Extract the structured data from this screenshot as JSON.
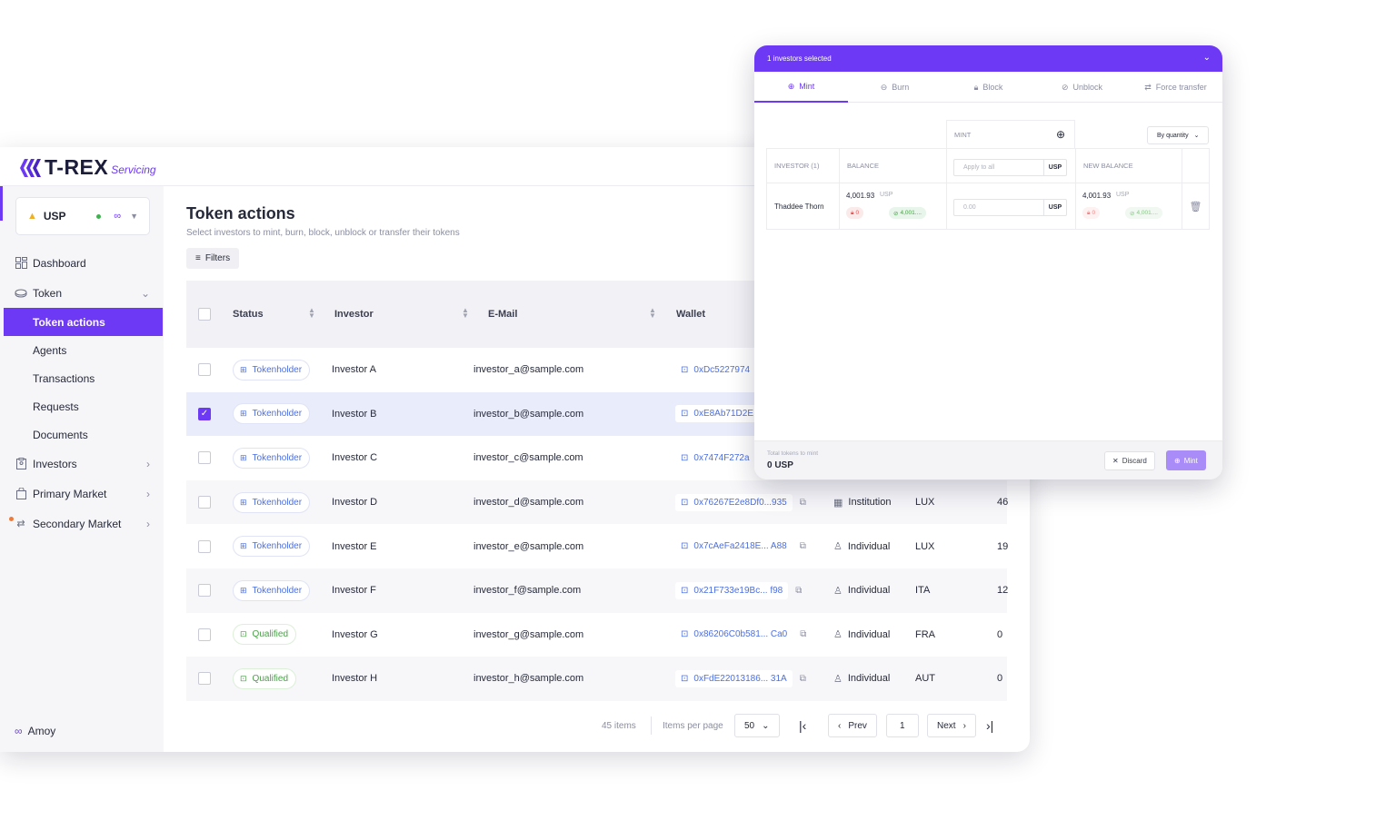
{
  "brand": {
    "name": "T-REX",
    "suffix": "Servicing",
    "accent": "#6d39f5"
  },
  "sidebar": {
    "token": {
      "symbol": "USP"
    },
    "items": [
      {
        "label": "Dashboard",
        "icon": "dashboard-icon"
      },
      {
        "label": "Token",
        "icon": "token-icon",
        "expanded": true
      }
    ],
    "token_sub": [
      "Token actions",
      "Agents",
      "Transactions",
      "Requests",
      "Documents"
    ],
    "more_items": [
      {
        "label": "Investors",
        "icon": "investors-icon"
      },
      {
        "label": "Primary Market",
        "icon": "primary-market-icon"
      },
      {
        "label": "Secondary Market",
        "icon": "secondary-market-icon"
      }
    ],
    "network": "Amoy"
  },
  "page": {
    "title": "Token actions",
    "subtitle": "Select investors to mint, burn, block, unblock or transfer their tokens",
    "filters_label": "Filters"
  },
  "table": {
    "columns": [
      "Status",
      "Investor",
      "E-Mail",
      "Wallet"
    ],
    "rows": [
      {
        "status": "Tokenholder",
        "investor": "Investor A",
        "email": "investor_a@sample.com",
        "wallet": "0xDc5227974",
        "type": "",
        "country": "",
        "amount": "",
        "checked": false
      },
      {
        "status": "Tokenholder",
        "investor": "Investor B",
        "email": "investor_b@sample.com",
        "wallet": "0xE8Ab71D2E",
        "type": "",
        "country": "",
        "amount": "",
        "checked": true
      },
      {
        "status": "Tokenholder",
        "investor": "Investor C",
        "email": "investor_c@sample.com",
        "wallet": "0x7474F272a",
        "type": "",
        "country": "",
        "amount": "",
        "checked": false
      },
      {
        "status": "Tokenholder",
        "investor": "Investor D",
        "email": "investor_d@sample.com",
        "wallet": "0x76267E2e8Df0...935",
        "type": "Institution",
        "country": "LUX",
        "amount": "46",
        "checked": false
      },
      {
        "status": "Tokenholder",
        "investor": "Investor E",
        "email": "investor_e@sample.com",
        "wallet": "0x7cAeFa2418E... A88",
        "type": "Individual",
        "country": "LUX",
        "amount": "19",
        "checked": false
      },
      {
        "status": "Tokenholder",
        "investor": "Investor F",
        "email": "investor_f@sample.com",
        "wallet": "0x21F733e19Bc... f98",
        "type": "Individual",
        "country": "ITA",
        "amount": "12",
        "checked": false
      },
      {
        "status": "Qualified",
        "investor": "Investor G",
        "email": "investor_g@sample.com",
        "wallet": "0x86206C0b581... Ca0",
        "type": "Individual",
        "country": "FRA",
        "amount": "0",
        "checked": false
      },
      {
        "status": "Qualified",
        "investor": "Investor H",
        "email": "investor_h@sample.com",
        "wallet": "0xFdE22013186... 31A",
        "type": "Individual",
        "country": "AUT",
        "amount": "0",
        "checked": false
      }
    ]
  },
  "pagination": {
    "total": "45 items",
    "per_page_label": "Items per page",
    "per_page": "50",
    "prev": "Prev",
    "page": "1",
    "next": "Next"
  },
  "panel": {
    "header": "1 investors selected",
    "tabs": [
      "Mint",
      "Burn",
      "Block",
      "Unblock",
      "Force transfer"
    ],
    "mode": "By quantity",
    "mint_col": "MINT",
    "col_investor": "INVESTOR (1)",
    "col_balance": "BALANCE",
    "apply_placeholder": "Apply to all",
    "unit": "USP",
    "col_new_balance": "NEW BALANCE",
    "row": {
      "name": "Thaddee Thorn",
      "balance": "4,001.93",
      "balance_unit": "USP",
      "blocked": "0",
      "free": "4,001....",
      "input_placeholder": "0.00",
      "new_balance": "4,001.93",
      "new_unit": "USP",
      "new_blocked": "0",
      "new_free": "4,001...."
    },
    "footer_label": "Total tokens to mint",
    "footer_value": "0 USP",
    "discard": "Discard",
    "mint": "Mint"
  }
}
